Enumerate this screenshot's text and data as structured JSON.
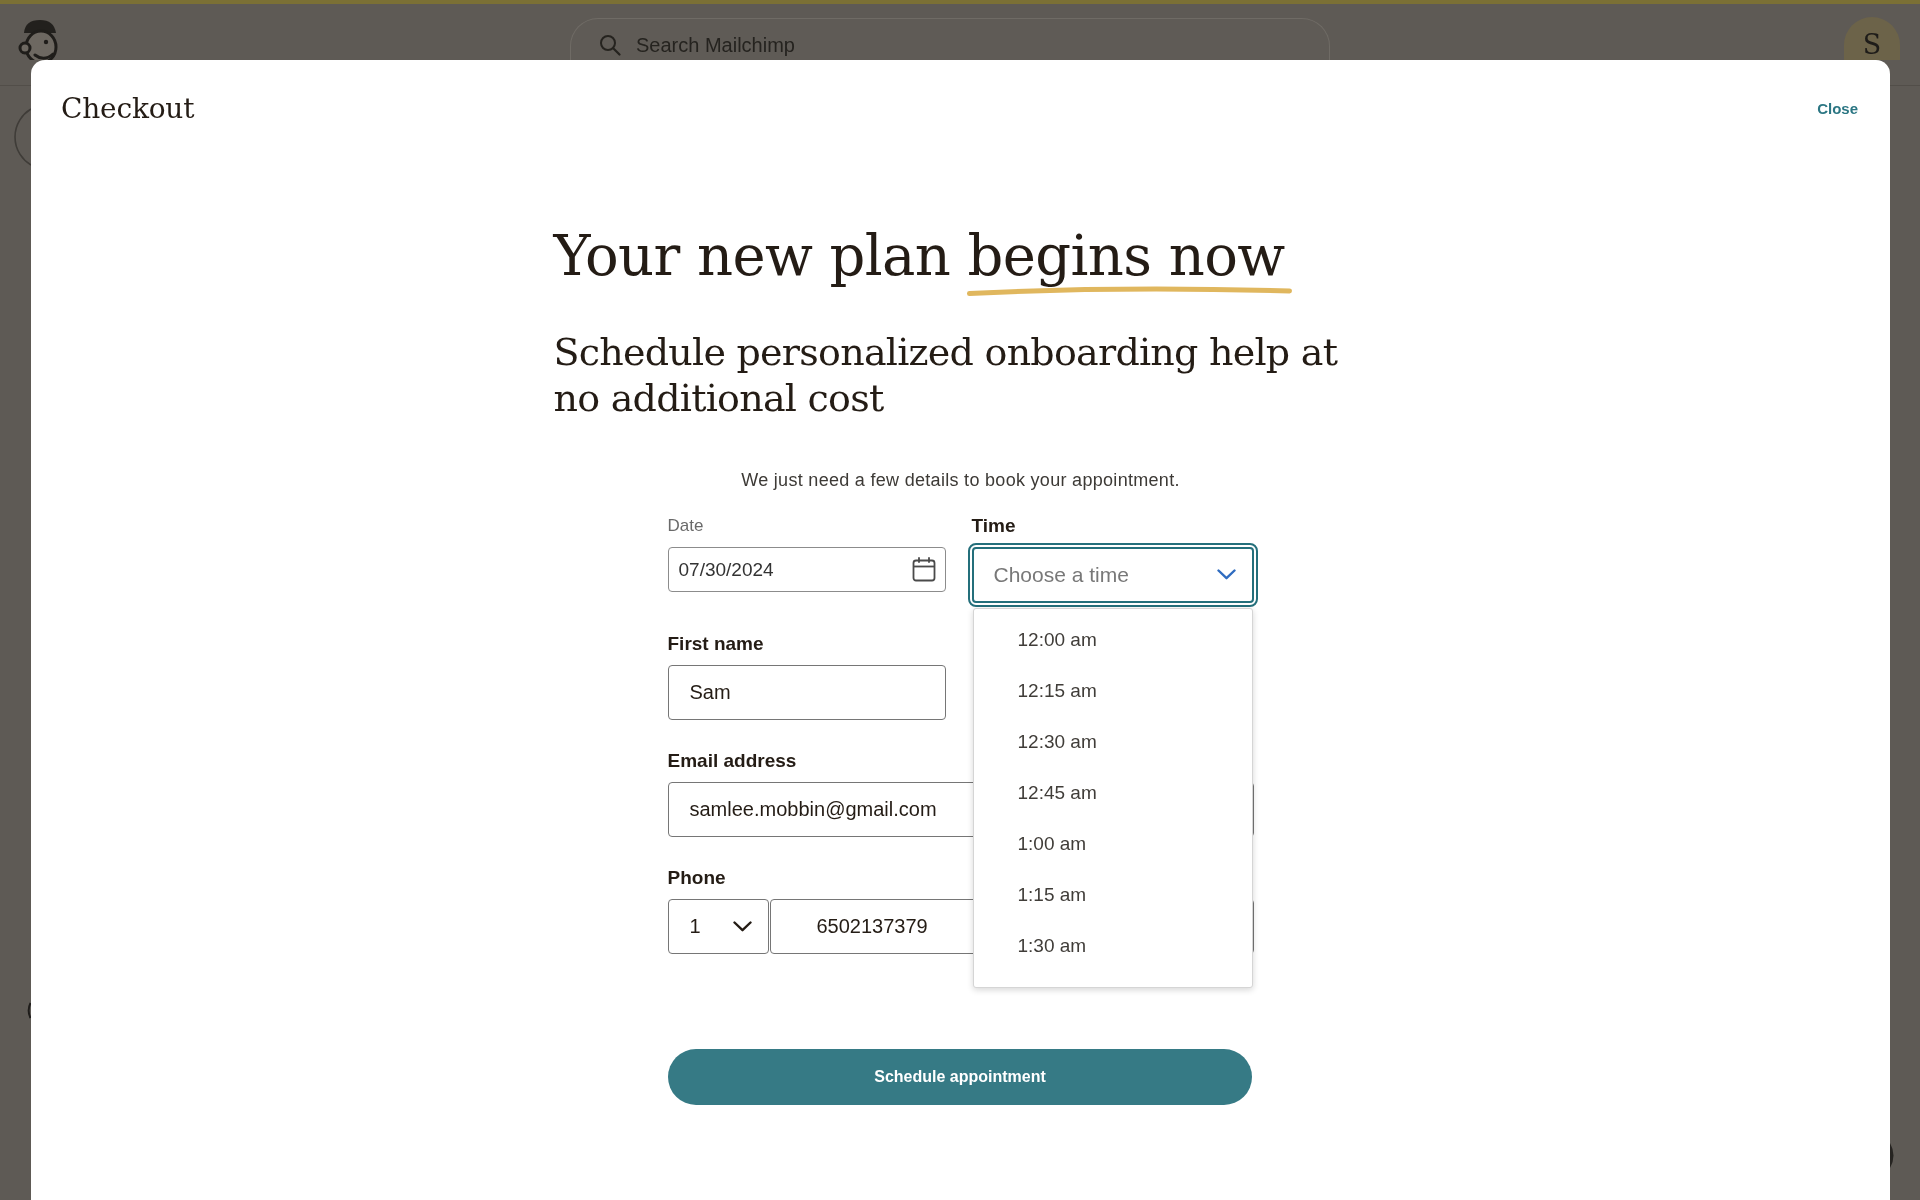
{
  "app_header": {
    "search": {
      "placeholder": "Search Mailchimp"
    },
    "avatar": "S"
  },
  "dialog": {
    "title": "Checkout",
    "close": "Close",
    "headline": {
      "text": "Your new plan",
      "underlined": "begins now"
    },
    "subheadline": "Schedule personalized onboarding help at no additional cost",
    "intro": "We just need a few details to book your appointment.",
    "fields": [
      {
        "kind": "date",
        "label": "Date",
        "value": "07/30/2024"
      },
      {
        "kind": "select",
        "label": "Time",
        "placeholder": "Choose a time",
        "expanded": true,
        "options": [
          {
            "label": "12:00 am",
            "selected": false
          },
          {
            "label": "12:15 am",
            "selected": false
          },
          {
            "label": "12:30 am",
            "selected": false
          },
          {
            "label": "12:45 am",
            "selected": false
          },
          {
            "label": "1:00 am",
            "selected": false
          },
          {
            "label": "1:15 am",
            "selected": false
          },
          {
            "label": "1:30 am",
            "selected": false
          }
        ]
      },
      {
        "kind": "text",
        "label": "First name",
        "value": "Sam"
      },
      {
        "kind": "email",
        "label": "Email address",
        "value": "samlee.mobbin@gmail.com"
      },
      {
        "kind": "tel",
        "label": "Phone",
        "country_code": "1",
        "value": "6502137379"
      }
    ],
    "submit": "Schedule appointment"
  }
}
